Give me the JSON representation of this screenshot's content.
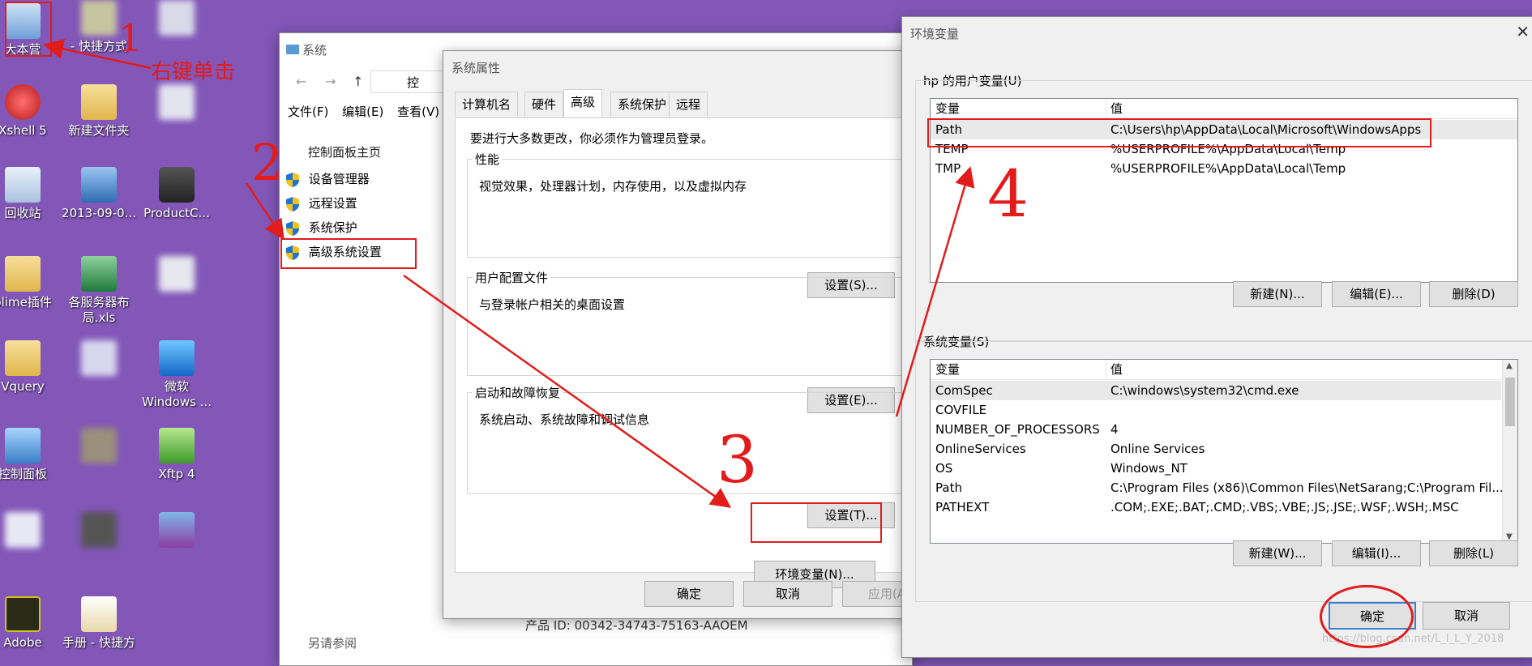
{
  "desktop": {
    "icons": [
      {
        "label": "大本营"
      },
      {
        "label": "- 快捷方式"
      },
      {
        "label": ""
      },
      {
        "label": "Xshell 5"
      },
      {
        "label": "新建文件夹"
      },
      {
        "label": ""
      },
      {
        "label": "回收站"
      },
      {
        "label": "2013-09-0..."
      },
      {
        "label": "ProductC..."
      },
      {
        "label": "blime插件"
      },
      {
        "label": "各服务器布局.xls"
      },
      {
        "label": ""
      },
      {
        "label": "Vquery"
      },
      {
        "label": ""
      },
      {
        "label": "微软Windows ..."
      },
      {
        "label": "控制面板"
      },
      {
        "label": ""
      },
      {
        "label": "Xftp 4"
      },
      {
        "label": ""
      },
      {
        "label": ""
      },
      {
        "label": ""
      },
      {
        "label": "Adobe"
      },
      {
        "label": "手册 - 快捷方"
      }
    ]
  },
  "annotations": {
    "one": "1",
    "right_click": "右键单击",
    "two": "2",
    "three": "3",
    "four": "4"
  },
  "system_window": {
    "title": "系统",
    "address": "控",
    "menu": [
      "文件(F)",
      "编辑(E)",
      "查看(V)"
    ],
    "home_link": "控制面板主页",
    "links": [
      "设备管理器",
      "远程设置",
      "系统保护",
      "高级系统设置"
    ],
    "product_id": "产品 ID: 00342-34743-75163-AAOEM",
    "see_also": "另请参阅"
  },
  "sysprops": {
    "title": "系统属性",
    "tabs": [
      "计算机名",
      "硬件",
      "高级",
      "系统保护",
      "远程"
    ],
    "admin_note": "要进行大多数更改，你必须作为管理员登录。",
    "perf_label": "性能",
    "perf_desc": "视觉效果，处理器计划，内存使用，以及虚拟内存",
    "perf_btn": "设置(S)...",
    "profile_label": "用户配置文件",
    "profile_desc": "与登录帐户相关的桌面设置",
    "profile_btn": "设置(E)...",
    "startup_label": "启动和故障恢复",
    "startup_desc": "系统启动、系统故障和调试信息",
    "startup_btn": "设置(T)...",
    "env_btn": "环境变量(N)...",
    "ok": "确定",
    "cancel": "取消",
    "apply": "应用(A"
  },
  "envvars": {
    "title": "环境变量",
    "user_label": "hp 的用户变量(U)",
    "col_var": "变量",
    "col_val": "值",
    "user_vars": [
      {
        "name": "Path",
        "value": "C:\\Users\\hp\\AppData\\Local\\Microsoft\\WindowsApps"
      },
      {
        "name": "TEMP",
        "value": "%USERPROFILE%\\AppData\\Local\\Temp"
      },
      {
        "name": "TMP",
        "value": "%USERPROFILE%\\AppData\\Local\\Temp"
      }
    ],
    "user_new": "新建(N)...",
    "user_edit": "编辑(E)...",
    "user_delete": "删除(D)",
    "sys_label": "系统变量(S)",
    "sys_vars": [
      {
        "name": "ComSpec",
        "value": "C:\\windows\\system32\\cmd.exe"
      },
      {
        "name": "COVFILE",
        "value": ""
      },
      {
        "name": "NUMBER_OF_PROCESSORS",
        "value": "4"
      },
      {
        "name": "OnlineServices",
        "value": "Online Services"
      },
      {
        "name": "OS",
        "value": "Windows_NT"
      },
      {
        "name": "Path",
        "value": "C:\\Program Files (x86)\\Common Files\\NetSarang;C:\\Program Fil..."
      },
      {
        "name": "PATHEXT",
        "value": ".COM;.EXE;.BAT;.CMD;.VBS;.VBE;.JS;.JSE;.WSF;.WSH;.MSC"
      }
    ],
    "sys_new": "新建(W)...",
    "sys_edit": "编辑(I)...",
    "sys_delete": "删除(L)",
    "ok": "确定",
    "cancel": "取消",
    "watermark": "https://blog.csdn.net/L_I_L_Y_2018"
  }
}
